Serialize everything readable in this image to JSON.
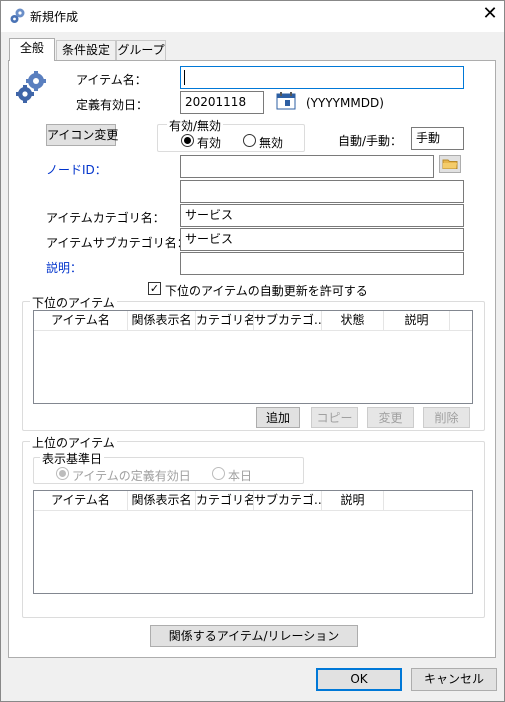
{
  "window": {
    "title": "新規作成",
    "close_glyph": "✕"
  },
  "tabs": [
    {
      "label": "全般",
      "active": true
    },
    {
      "label": "条件設定",
      "active": false
    },
    {
      "label": "グループ",
      "active": false
    }
  ],
  "general": {
    "item_name": {
      "label": "アイテム名：",
      "value": ""
    },
    "effective_date": {
      "label": "定義有効日：",
      "value": "20201118",
      "format_hint": "(YYYYMMDD)"
    },
    "icon_change_button": "アイコン変更",
    "enabled_group": {
      "title": "有効/無効",
      "options": [
        "有効",
        "無効"
      ],
      "selected": "有効"
    },
    "auto_manual": {
      "label": "自動/手動：",
      "value": "手動"
    },
    "node_id": {
      "label": "ノードID：",
      "value": "",
      "value2": ""
    },
    "item_category": {
      "label": "アイテムカテゴリ名：",
      "value": "サービス"
    },
    "item_subcategory": {
      "label": "アイテムサブカテゴリ名：",
      "value": "サービス"
    },
    "description": {
      "label": "説明：",
      "value": ""
    },
    "auto_update_checkbox": {
      "label": "下位のアイテムの自動更新を許可する",
      "checked": true
    }
  },
  "lower_items": {
    "title": "下位のアイテム",
    "columns": [
      "アイテム名",
      "関係表示名",
      "カテゴリ名",
      "サブカテゴ...",
      "状態",
      "説明"
    ],
    "buttons": {
      "add": "追加",
      "copy": "コピー",
      "edit": "変更",
      "delete": "削除"
    }
  },
  "upper_items": {
    "title": "上位のアイテム",
    "base_date": {
      "title": "表示基準日",
      "options": [
        "アイテムの定義有効日",
        "本日"
      ],
      "selected": "アイテムの定義有効日"
    },
    "columns": [
      "アイテム名",
      "関係表示名",
      "カテゴリ名",
      "サブカテゴ...",
      "説明"
    ]
  },
  "relation_button": "関係するアイテム/リレーション",
  "footer": {
    "ok": "OK",
    "cancel": "キャンセル"
  },
  "icons": {
    "app": "gears-icon",
    "calendar": "calendar-icon",
    "folder": "folder-icon"
  },
  "colors": {
    "accent": "#0078d7",
    "link_label": "#0033cc"
  }
}
